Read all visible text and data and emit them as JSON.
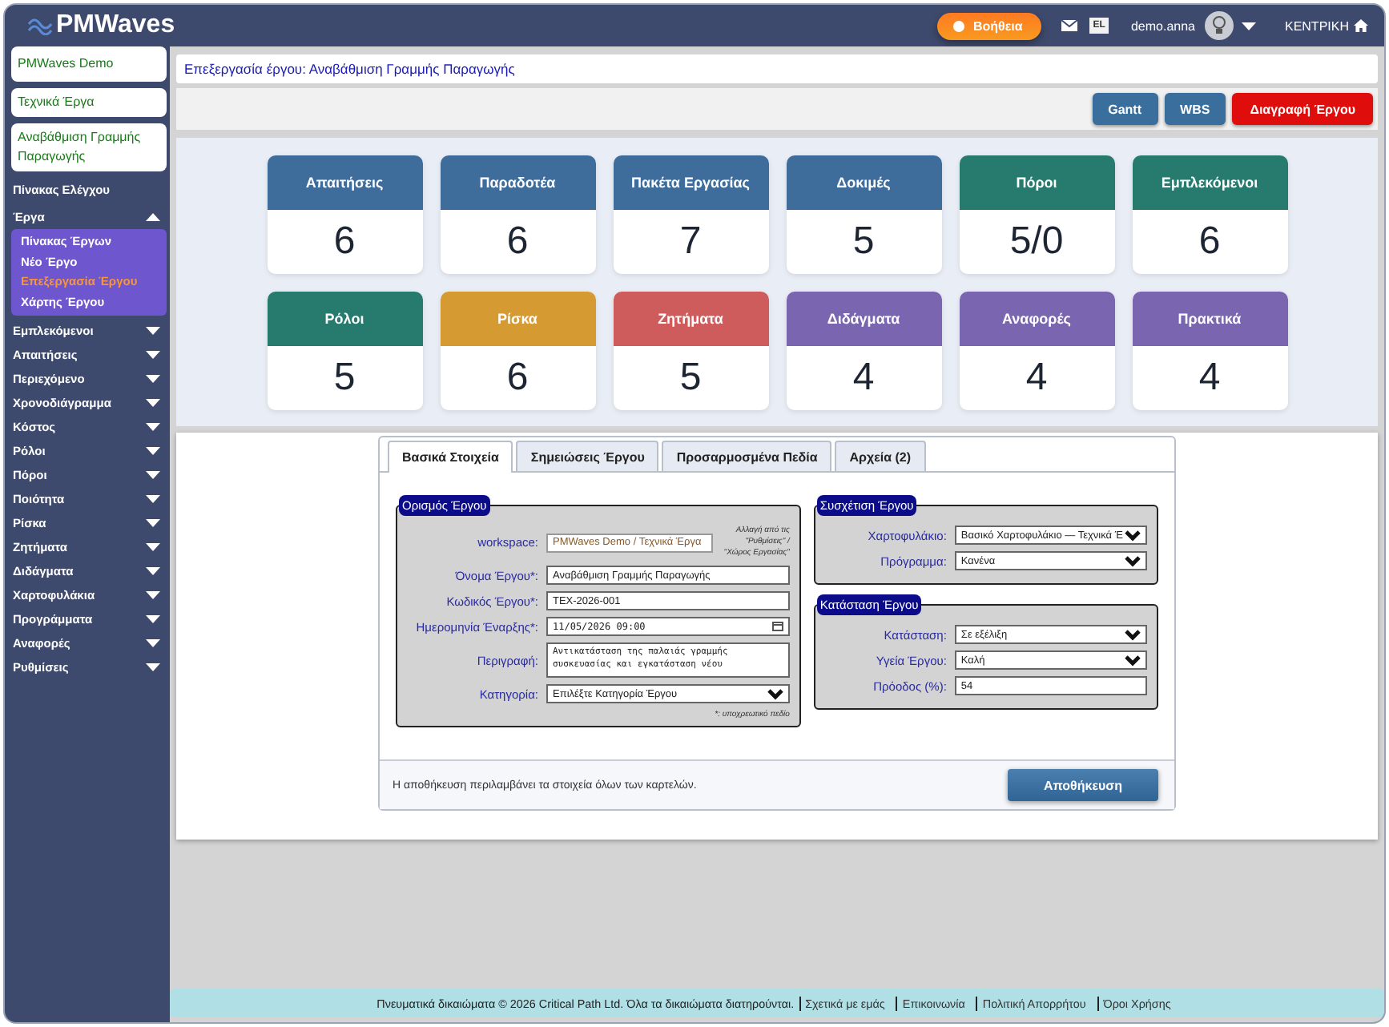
{
  "header": {
    "logo": "PMWaves",
    "help_button": "Βοήθεια",
    "language": "EL",
    "user": "demo.anna",
    "home_link": "ΚΕΝΤΡΙΚΗ"
  },
  "sidebar": {
    "context": [
      "PMWaves Demo",
      "Τεχνικά Έργα",
      "Αναβάθμιση Γραμμής Παραγωγής"
    ],
    "items": [
      {
        "label": "Πίνακας Ελέγχου"
      },
      {
        "label": "Έργα",
        "expanded": true,
        "children": [
          {
            "label": "Πίνακας Έργων",
            "selected": false
          },
          {
            "label": "Νέο Έργο",
            "selected": false
          },
          {
            "label": "Επεξεργασία Έργου",
            "selected": true
          },
          {
            "label": "Χάρτης Έργου",
            "selected": false
          }
        ]
      },
      {
        "label": "Εμπλεκόμενοι",
        "expanded": false
      },
      {
        "label": "Απαιτήσεις",
        "expanded": false
      },
      {
        "label": "Περιεχόμενο",
        "expanded": false
      },
      {
        "label": "Χρονοδιάγραμμα",
        "expanded": false
      },
      {
        "label": "Κόστος",
        "expanded": false
      },
      {
        "label": "Ρόλοι",
        "expanded": false
      },
      {
        "label": "Πόροι",
        "expanded": false
      },
      {
        "label": "Ποιότητα",
        "expanded": false
      },
      {
        "label": "Ρίσκα",
        "expanded": false
      },
      {
        "label": "Ζητήματα",
        "expanded": false
      },
      {
        "label": "Διδάγματα",
        "expanded": false
      },
      {
        "label": "Χαρτοφυλάκια",
        "expanded": false
      },
      {
        "label": "Προγράμματα",
        "expanded": false
      },
      {
        "label": "Αναφορές",
        "expanded": false
      },
      {
        "label": "Ρυθμίσεις",
        "expanded": false
      }
    ]
  },
  "page_title": "Επεξεργασία έργου: Αναβάθμιση Γραμμής Παραγωγής",
  "toolbar": [
    {
      "label": "Gantt",
      "kind": "primary"
    },
    {
      "label": "WBS",
      "kind": "primary"
    },
    {
      "label": "Διαγραφή Έργου",
      "kind": "danger"
    }
  ],
  "stat_cards": [
    {
      "title": "Απαιτήσεις",
      "value": "6",
      "color": "#3e6d9c"
    },
    {
      "title": "Παραδοτέα",
      "value": "6",
      "color": "#3e6d9c"
    },
    {
      "title": "Πακέτα Εργασίας",
      "value": "7",
      "color": "#3e6d9c"
    },
    {
      "title": "Δοκιμές",
      "value": "5",
      "color": "#3e6d9c"
    },
    {
      "title": "Πόροι",
      "value": "5/0",
      "color": "#267a6e"
    },
    {
      "title": "Εμπλεκόμενοι",
      "value": "6",
      "color": "#267a6e"
    },
    {
      "title": "Ρόλοι",
      "value": "5",
      "color": "#267a6e"
    },
    {
      "title": "Ρίσκα",
      "value": "6",
      "color": "#d69a32"
    },
    {
      "title": "Ζητήματα",
      "value": "5",
      "color": "#cf5c5c"
    },
    {
      "title": "Διδάγματα",
      "value": "4",
      "color": "#7a66b0"
    },
    {
      "title": "Αναφορές",
      "value": "4",
      "color": "#7a66b0"
    },
    {
      "title": "Πρακτικά",
      "value": "4",
      "color": "#7a66b0"
    }
  ],
  "tabs": [
    {
      "label": "Βασικά Στοιχεία",
      "selected": true
    },
    {
      "label": "Σημειώσεις Έργου",
      "selected": false
    },
    {
      "label": "Προσαρμοσμένα Πεδία",
      "selected": false
    },
    {
      "label": "Αρχεία (2)",
      "selected": false
    }
  ],
  "definition": {
    "legend": "Ορισμός Έργου",
    "fields": [
      {
        "label": "workspace:",
        "kind": "readonly",
        "value": "PMWaves Demo / Τεχνικά Έργα",
        "note": "Αλλαγή από τις \"Ρυθμίσεις\" / \"Χώρος Εργασίας\""
      },
      {
        "label": "Όνομα Έργου*:",
        "kind": "text",
        "value": "Αναβάθμιση Γραμμής Παραγωγής"
      },
      {
        "label": "Κωδικός Έργου*:",
        "kind": "text",
        "value": "TEX-2026-001"
      },
      {
        "label": "Ημερομηνία Έναρξης*:",
        "kind": "datetime",
        "value": "11/05/2026 09:00"
      },
      {
        "label": "Περιγραφή:",
        "kind": "textarea",
        "value": "Αντικατάσταση της παλαιάς γραμμής συσκευασίας και εγκατάσταση νέου"
      },
      {
        "label": "Κατηγορία:",
        "kind": "select",
        "value": "Επιλέξτε Κατηγορία Έργου"
      }
    ],
    "footnote": "*: υποχρεωτικό πεδίο"
  },
  "relation": {
    "legend": "Συσχέτιση Έργου",
    "fields": [
      {
        "label": "Χαρτοφυλάκιο:",
        "kind": "select",
        "value": "Βασικό Χαρτοφυλάκιο — Τεχνικά Έ"
      },
      {
        "label": "Πρόγραμμα:",
        "kind": "select",
        "value": "Κανένα"
      }
    ]
  },
  "status": {
    "legend": "Κατάσταση Έργου",
    "fields": [
      {
        "label": "Κατάσταση:",
        "kind": "select",
        "value": "Σε εξέλιξη"
      },
      {
        "label": "Υγεία Έργου:",
        "kind": "select",
        "value": "Καλή"
      },
      {
        "label": "Πρόοδος (%):",
        "kind": "text",
        "value": "54"
      }
    ]
  },
  "save_note": "Η αποθήκευση περιλαμβάνει τα στοιχεία όλων των καρτελών.",
  "save_button": "Αποθήκευση",
  "footer": {
    "copyright": "Πνευματικά δικαιώματα © 2026 Critical Path Ltd. Όλα τα δικαιώματα διατηρούνται.",
    "links": [
      "Σχετικά με εμάς",
      "Επικοινωνία",
      "Πολιτική Απορρήτου",
      "Όροι Χρήσης"
    ]
  }
}
